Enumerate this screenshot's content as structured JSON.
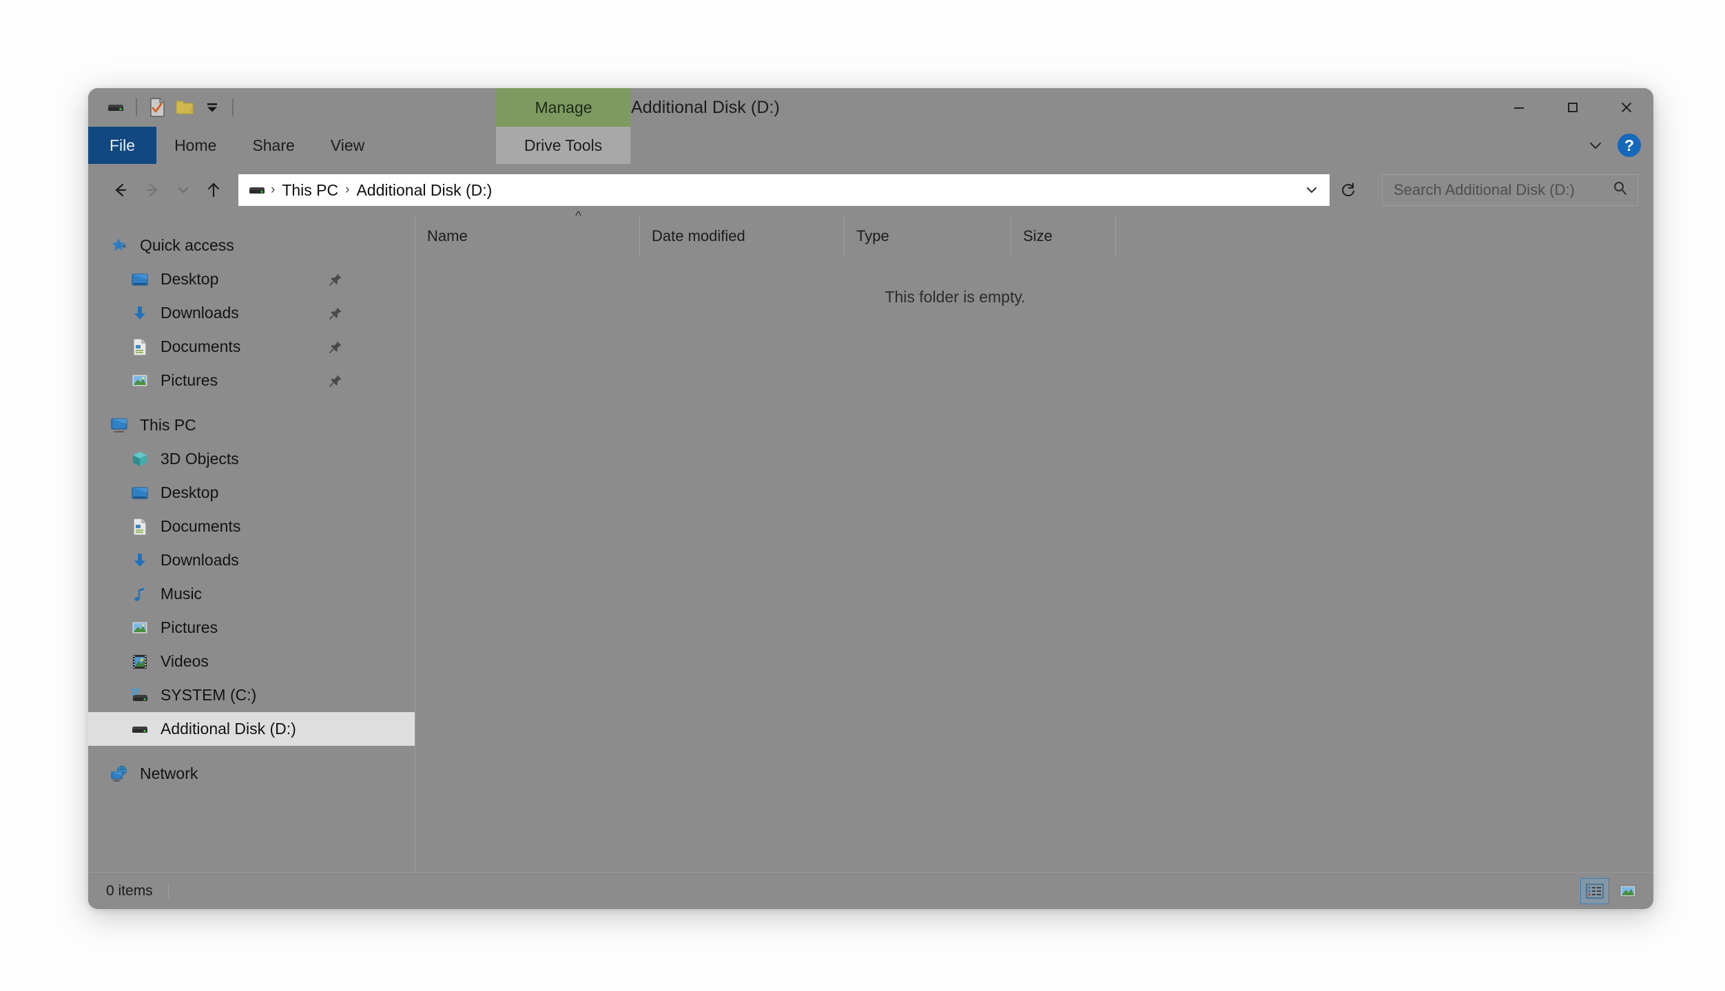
{
  "window": {
    "title": "Additional Disk (D:)",
    "controls": {
      "minimize": "minimize-button",
      "maximize": "maximize-button",
      "close": "close-button"
    }
  },
  "quick_access_toolbar": {
    "icons": [
      "drive-icon",
      "properties-icon",
      "new-folder-icon",
      "customize-dropdown-icon"
    ]
  },
  "ribbon": {
    "tabs": [
      {
        "label": "File",
        "id": "file"
      },
      {
        "label": "Home",
        "id": "home"
      },
      {
        "label": "Share",
        "id": "share"
      },
      {
        "label": "View",
        "id": "view"
      }
    ],
    "contextual_group": {
      "header": "Manage",
      "tab": "Drive Tools"
    },
    "collapse_icon": "chevron-down-icon",
    "help": "?"
  },
  "address_bar": {
    "back": "back-arrow-icon",
    "forward": "forward-arrow-icon",
    "recent": "recent-locations-chevron-icon",
    "up": "up-arrow-icon",
    "path_icon": "drive-icon",
    "breadcrumbs": [
      "This PC",
      "Additional Disk (D:)"
    ],
    "separator": "›",
    "dropdown": "chevron-down-icon",
    "refresh": "refresh-icon"
  },
  "search": {
    "placeholder": "Search Additional Disk (D:)",
    "value": "",
    "icon": "search-icon"
  },
  "sidebar": {
    "groups": [
      {
        "id": "quick-access",
        "header": {
          "label": "Quick access",
          "icon": "star-pin-icon"
        },
        "items": [
          {
            "label": "Desktop",
            "icon": "desktop-icon",
            "pinned": true
          },
          {
            "label": "Downloads",
            "icon": "downloads-icon",
            "pinned": true
          },
          {
            "label": "Documents",
            "icon": "documents-icon",
            "pinned": true
          },
          {
            "label": "Pictures",
            "icon": "pictures-icon",
            "pinned": true
          }
        ]
      },
      {
        "id": "this-pc",
        "header": {
          "label": "This PC",
          "icon": "this-pc-icon"
        },
        "items": [
          {
            "label": "3D Objects",
            "icon": "3d-objects-icon",
            "pinned": false
          },
          {
            "label": "Desktop",
            "icon": "desktop-icon",
            "pinned": false
          },
          {
            "label": "Documents",
            "icon": "documents-icon",
            "pinned": false
          },
          {
            "label": "Downloads",
            "icon": "downloads-icon",
            "pinned": false
          },
          {
            "label": "Music",
            "icon": "music-icon",
            "pinned": false
          },
          {
            "label": "Pictures",
            "icon": "pictures-icon",
            "pinned": false
          },
          {
            "label": "Videos",
            "icon": "videos-icon",
            "pinned": false
          },
          {
            "label": "SYSTEM (C:)",
            "icon": "system-drive-icon",
            "pinned": false
          },
          {
            "label": "Additional Disk (D:)",
            "icon": "drive-icon",
            "pinned": false,
            "selected": true
          }
        ]
      },
      {
        "id": "network",
        "header": {
          "label": "Network",
          "icon": "network-icon"
        },
        "items": []
      }
    ]
  },
  "file_list": {
    "columns": [
      {
        "label": "Name",
        "sorted": true,
        "sort_direction": "ascending"
      },
      {
        "label": "Date modified"
      },
      {
        "label": "Type"
      },
      {
        "label": "Size"
      }
    ],
    "rows": [],
    "empty_message": "This folder is empty."
  },
  "status_bar": {
    "item_count": "0 items",
    "views": [
      {
        "id": "details-view",
        "icon": "details-view-icon",
        "active": true
      },
      {
        "id": "large-icons-view",
        "icon": "large-icons-view-icon",
        "active": false
      }
    ]
  },
  "colors": {
    "window_chrome": "#8c8c8c",
    "file_tab": "#11487f",
    "contextual_header": "#7d9a61",
    "contextual_tab": "#a8a8a8",
    "selection": "#dedede",
    "accent_blue": "#1668ba"
  }
}
